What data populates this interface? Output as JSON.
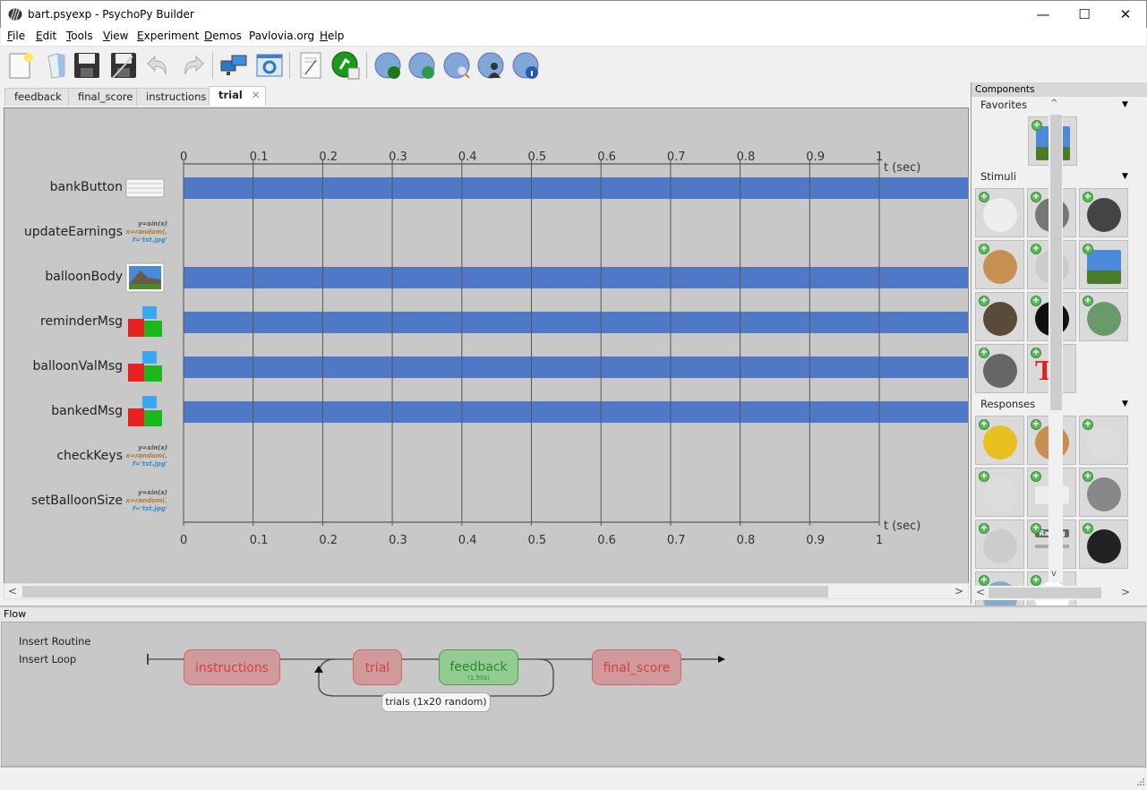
{
  "window": {
    "title": "bart.psyexp - PsychoPy Builder",
    "controls": {
      "minimize": "—",
      "maximize": "☐",
      "close": "✕"
    }
  },
  "menu": [
    {
      "label": "File",
      "accel": "F",
      "rest": "ile"
    },
    {
      "label": "Edit",
      "accel": "E",
      "rest": "dit"
    },
    {
      "label": "Tools",
      "accel": "T",
      "rest": "ools"
    },
    {
      "label": "View",
      "accel": "V",
      "rest": "iew"
    },
    {
      "label": "Experiment",
      "accel": "E",
      "rest": "xperiment"
    },
    {
      "label": "Demos",
      "accel": "D",
      "rest": "emos"
    },
    {
      "label": "Pavlovia.org",
      "accel": "",
      "rest": "Pavlovia.org"
    },
    {
      "label": "Help",
      "accel": "H",
      "rest": "elp"
    }
  ],
  "toolbar": {
    "buttons": [
      "new-file",
      "open-file",
      "save",
      "save-as",
      "undo",
      "redo",
      "monitor-center",
      "experiment-settings",
      "compile-script",
      "run",
      "pavlovia-sync-run",
      "pavlovia-sync",
      "pavlovia-search",
      "pavlovia-user",
      "pavlovia-project-info"
    ]
  },
  "tabs": [
    {
      "label": "feedback",
      "active": false
    },
    {
      "label": "final_score",
      "active": false
    },
    {
      "label": "instructions",
      "active": false
    },
    {
      "label": "trial",
      "active": true,
      "close": "✕"
    }
  ],
  "routine": {
    "time_axis": {
      "ticks": [
        "0",
        "0.1",
        "0.2",
        "0.3",
        "0.4",
        "0.5",
        "0.6",
        "0.7",
        "0.8",
        "0.9",
        "1"
      ],
      "unit_label": "t (sec)",
      "min": 0,
      "max": 1
    },
    "bar_color": "#4f79c6",
    "components": [
      {
        "name": "bankButton",
        "icon": "keyboard-icon",
        "has_bar": true
      },
      {
        "name": "updateEarnings",
        "icon": "code-icon",
        "has_bar": false
      },
      {
        "name": "balloonBody",
        "icon": "image-icon",
        "has_bar": true
      },
      {
        "name": "reminderMsg",
        "icon": "text-blocks-icon",
        "has_bar": true
      },
      {
        "name": "balloonValMsg",
        "icon": "text-blocks-icon",
        "has_bar": true
      },
      {
        "name": "bankedMsg",
        "icon": "text-blocks-icon",
        "has_bar": true
      },
      {
        "name": "checkKeys",
        "icon": "code-icon",
        "has_bar": false
      },
      {
        "name": "setBalloonSize",
        "icon": "code-icon",
        "has_bar": false
      }
    ],
    "code_icon_lines": [
      "y=sin(x)",
      "x=random(,",
      "f='tst.jpg'"
    ]
  },
  "components_panel": {
    "title": "Components",
    "categories": [
      {
        "label": "Favorites",
        "items": [
          "image"
        ]
      },
      {
        "label": "Stimuli",
        "items": [
          "aperture",
          "dots",
          "grating",
          "form",
          "envelope-grating",
          "image",
          "movie",
          "noise",
          "polygon",
          "sound",
          "text"
        ]
      },
      {
        "label": "Responses",
        "items": [
          "brush",
          "form",
          "joystick",
          "joybuttons",
          "keyboard",
          "microphone",
          "mouse",
          "rating-scale",
          "slider",
          "button",
          "textbox"
        ]
      }
    ],
    "rating_label": "Rating"
  },
  "flow": {
    "header": "Flow",
    "insert_routine": "Insert Routine",
    "insert_loop": "Insert Loop",
    "routines": [
      {
        "label": "instructions",
        "color": "red"
      },
      {
        "label": "trial",
        "color": "red"
      },
      {
        "label": "feedback",
        "color": "green",
        "duration": "(1.50s)"
      },
      {
        "label": "final_score",
        "color": "red"
      }
    ],
    "loop": {
      "label": "trials  (1x20 random)"
    }
  },
  "scroll": {
    "left": "<",
    "right": ">",
    "up": "^",
    "down": "v"
  }
}
